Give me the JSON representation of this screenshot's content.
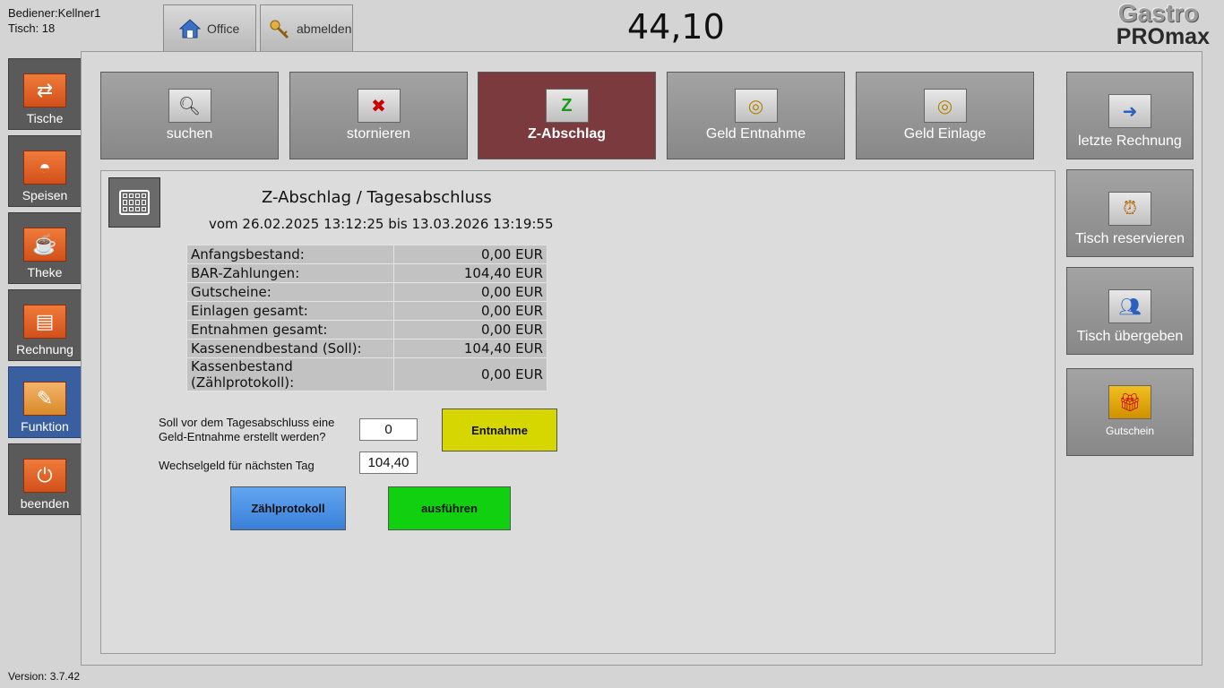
{
  "header": {
    "operator": "Bediener:Kellner1",
    "table": "Tisch: 18",
    "total": "44,10",
    "logo_line1": "Gastro",
    "logo_line2": "PROmax",
    "version": "Version: 3.7.42"
  },
  "top_buttons": {
    "office": "Office",
    "logout": "abmelden"
  },
  "sidebar": {
    "items": [
      {
        "label": "Tische",
        "icon": "arrows-icon"
      },
      {
        "label": "Speisen",
        "icon": "cloche-icon"
      },
      {
        "label": "Theke",
        "icon": "coffee-cup-icon"
      },
      {
        "label": "Rechnung",
        "icon": "receipt-printer-icon"
      },
      {
        "label": "Funktion",
        "icon": "function-panel-icon",
        "active": true
      },
      {
        "label": "beenden",
        "icon": "power-icon"
      }
    ]
  },
  "functions": {
    "items": [
      {
        "label": "suchen",
        "icon": "magnifier-icon"
      },
      {
        "label": "stornieren",
        "icon": "cancel-receipt-icon"
      },
      {
        "label": "Z-Abschlag",
        "icon": "z-report-icon",
        "active": true
      },
      {
        "label": "Geld Entnahme",
        "icon": "coins-out-icon"
      },
      {
        "label": "Geld Einlage",
        "icon": "coins-in-icon"
      }
    ]
  },
  "right_actions": {
    "items": [
      {
        "label": "letzte Rechnung",
        "icon": "arrow-right-icon"
      },
      {
        "label": "Tisch reservieren",
        "icon": "alarm-clock-icon"
      },
      {
        "label": "Tisch übergeben",
        "icon": "users-icon"
      },
      {
        "label": "Gutschein",
        "icon": "voucher-icon"
      }
    ]
  },
  "report": {
    "title": "Z-Abschlag / Tagesabschluss",
    "period": "vom 26.02.2025 13:12:25 bis 13.03.2026 13:19:55",
    "rows": [
      {
        "label": "Anfangsbestand:",
        "value": "0,00 EUR"
      },
      {
        "label": "BAR-Zahlungen:",
        "value": "104,40 EUR"
      },
      {
        "label": "Gutscheine:",
        "value": "0,00 EUR"
      },
      {
        "label": "Einlagen gesamt:",
        "value": "0,00 EUR"
      },
      {
        "label": "Entnahmen gesamt:",
        "value": "0,00 EUR"
      },
      {
        "label": "Kassenendbestand (Soll):",
        "value": "104,40 EUR"
      },
      {
        "label": "Kassenbestand (Zählprotokoll):",
        "value": "0,00 EUR"
      }
    ]
  },
  "form": {
    "withdrawal_question_line1": "Soll vor dem Tagesabschluss eine",
    "withdrawal_question_line2": "Geld-Entnahme erstellt werden?",
    "withdrawal_value": "0",
    "change_label": "Wechselgeld für nächsten Tag",
    "change_value": "104,40",
    "withdrawal_button": "Entnahme",
    "count_button": "Zählprotokoll",
    "execute_button": "ausführen"
  },
  "colors": {
    "active_function": "#7a3a3e",
    "active_sidebar": "#3a5fa0",
    "entnahme_button": "#d6d600",
    "count_button": "#4a90e2",
    "execute_button": "#10d010"
  }
}
